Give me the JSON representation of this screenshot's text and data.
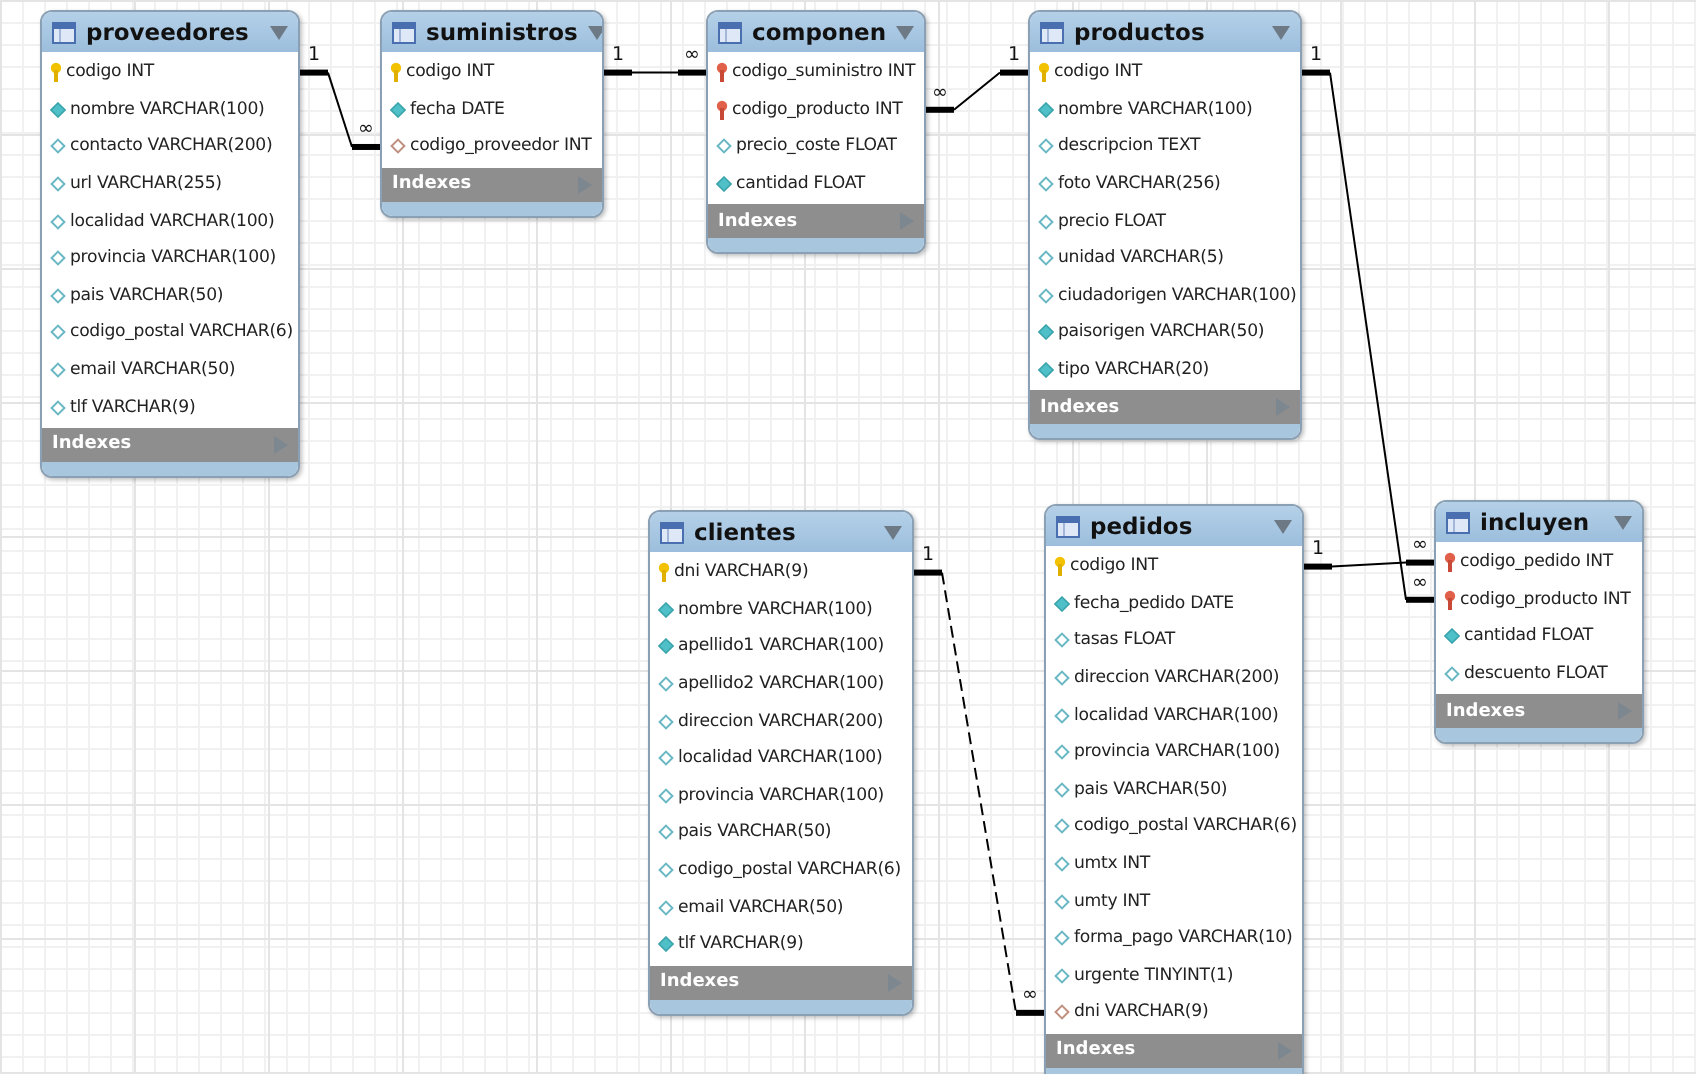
{
  "tables": [
    {
      "name": "proveedores",
      "indexes": "Indexes",
      "columns": [
        {
          "name": "codigo INT",
          "kind": "pk"
        },
        {
          "name": "nombre VARCHAR(100)",
          "kind": "nn"
        },
        {
          "name": "contacto VARCHAR(200)",
          "kind": "null"
        },
        {
          "name": "url VARCHAR(255)",
          "kind": "null"
        },
        {
          "name": "localidad VARCHAR(100)",
          "kind": "null"
        },
        {
          "name": "provincia VARCHAR(100)",
          "kind": "null"
        },
        {
          "name": "pais VARCHAR(50)",
          "kind": "null"
        },
        {
          "name": "codigo_postal VARCHAR(6)",
          "kind": "null"
        },
        {
          "name": "email VARCHAR(50)",
          "kind": "null"
        },
        {
          "name": "tlf VARCHAR(9)",
          "kind": "null"
        }
      ]
    },
    {
      "name": "suministros",
      "indexes": "Indexes",
      "columns": [
        {
          "name": "codigo INT",
          "kind": "pk"
        },
        {
          "name": "fecha DATE",
          "kind": "nn"
        },
        {
          "name": "codigo_proveedor INT",
          "kind": "fk"
        }
      ]
    },
    {
      "name": "componen",
      "indexes": "Indexes",
      "columns": [
        {
          "name": "codigo_suministro INT",
          "kind": "fkpk"
        },
        {
          "name": "codigo_producto INT",
          "kind": "fkpk"
        },
        {
          "name": "precio_coste FLOAT",
          "kind": "null"
        },
        {
          "name": "cantidad FLOAT",
          "kind": "nn"
        }
      ]
    },
    {
      "name": "productos",
      "indexes": "Indexes",
      "columns": [
        {
          "name": "codigo INT",
          "kind": "pk"
        },
        {
          "name": "nombre VARCHAR(100)",
          "kind": "nn"
        },
        {
          "name": "descripcion TEXT",
          "kind": "null"
        },
        {
          "name": "foto VARCHAR(256)",
          "kind": "null"
        },
        {
          "name": "precio FLOAT",
          "kind": "null"
        },
        {
          "name": "unidad VARCHAR(5)",
          "kind": "null"
        },
        {
          "name": "ciudadorigen VARCHAR(100)",
          "kind": "null"
        },
        {
          "name": "paisorigen VARCHAR(50)",
          "kind": "nn"
        },
        {
          "name": "tipo VARCHAR(20)",
          "kind": "nn"
        }
      ]
    },
    {
      "name": "clientes",
      "indexes": "Indexes",
      "columns": [
        {
          "name": "dni VARCHAR(9)",
          "kind": "pk"
        },
        {
          "name": "nombre VARCHAR(100)",
          "kind": "nn"
        },
        {
          "name": "apellido1 VARCHAR(100)",
          "kind": "nn"
        },
        {
          "name": "apellido2 VARCHAR(100)",
          "kind": "null"
        },
        {
          "name": "direccion VARCHAR(200)",
          "kind": "null"
        },
        {
          "name": "localidad VARCHAR(100)",
          "kind": "null"
        },
        {
          "name": "provincia VARCHAR(100)",
          "kind": "null"
        },
        {
          "name": "pais VARCHAR(50)",
          "kind": "null"
        },
        {
          "name": "codigo_postal VARCHAR(6)",
          "kind": "null"
        },
        {
          "name": "email VARCHAR(50)",
          "kind": "null"
        },
        {
          "name": "tlf VARCHAR(9)",
          "kind": "nn"
        }
      ]
    },
    {
      "name": "pedidos",
      "indexes": "Indexes",
      "columns": [
        {
          "name": "codigo INT",
          "kind": "pk"
        },
        {
          "name": "fecha_pedido DATE",
          "kind": "nn"
        },
        {
          "name": "tasas FLOAT",
          "kind": "null"
        },
        {
          "name": "direccion VARCHAR(200)",
          "kind": "null"
        },
        {
          "name": "localidad VARCHAR(100)",
          "kind": "null"
        },
        {
          "name": "provincia VARCHAR(100)",
          "kind": "null"
        },
        {
          "name": "pais VARCHAR(50)",
          "kind": "null"
        },
        {
          "name": "codigo_postal VARCHAR(6)",
          "kind": "null"
        },
        {
          "name": "umtx INT",
          "kind": "null"
        },
        {
          "name": "umty INT",
          "kind": "null"
        },
        {
          "name": "forma_pago VARCHAR(10)",
          "kind": "null"
        },
        {
          "name": "urgente TINYINT(1)",
          "kind": "null"
        },
        {
          "name": "dni VARCHAR(9)",
          "kind": "fk"
        }
      ]
    },
    {
      "name": "incluyen",
      "indexes": "Indexes",
      "columns": [
        {
          "name": "codigo_pedido INT",
          "kind": "fkpk"
        },
        {
          "name": "codigo_producto INT",
          "kind": "fkpk"
        },
        {
          "name": "cantidad FLOAT",
          "kind": "nn"
        },
        {
          "name": "descuento FLOAT",
          "kind": "null"
        }
      ]
    }
  ],
  "relationships": [
    {
      "one_label": "1",
      "many_label": "∞",
      "identifying": true
    },
    {
      "one_label": "1",
      "many_label": "∞",
      "identifying": true
    },
    {
      "one_label": "1",
      "many_label": "∞",
      "identifying": true
    },
    {
      "one_label": "1",
      "many_label": "∞",
      "identifying": true
    },
    {
      "one_label": "1",
      "many_label": "∞",
      "identifying": true
    },
    {
      "one_label": "1",
      "many_label": "∞",
      "identifying": false
    }
  ]
}
